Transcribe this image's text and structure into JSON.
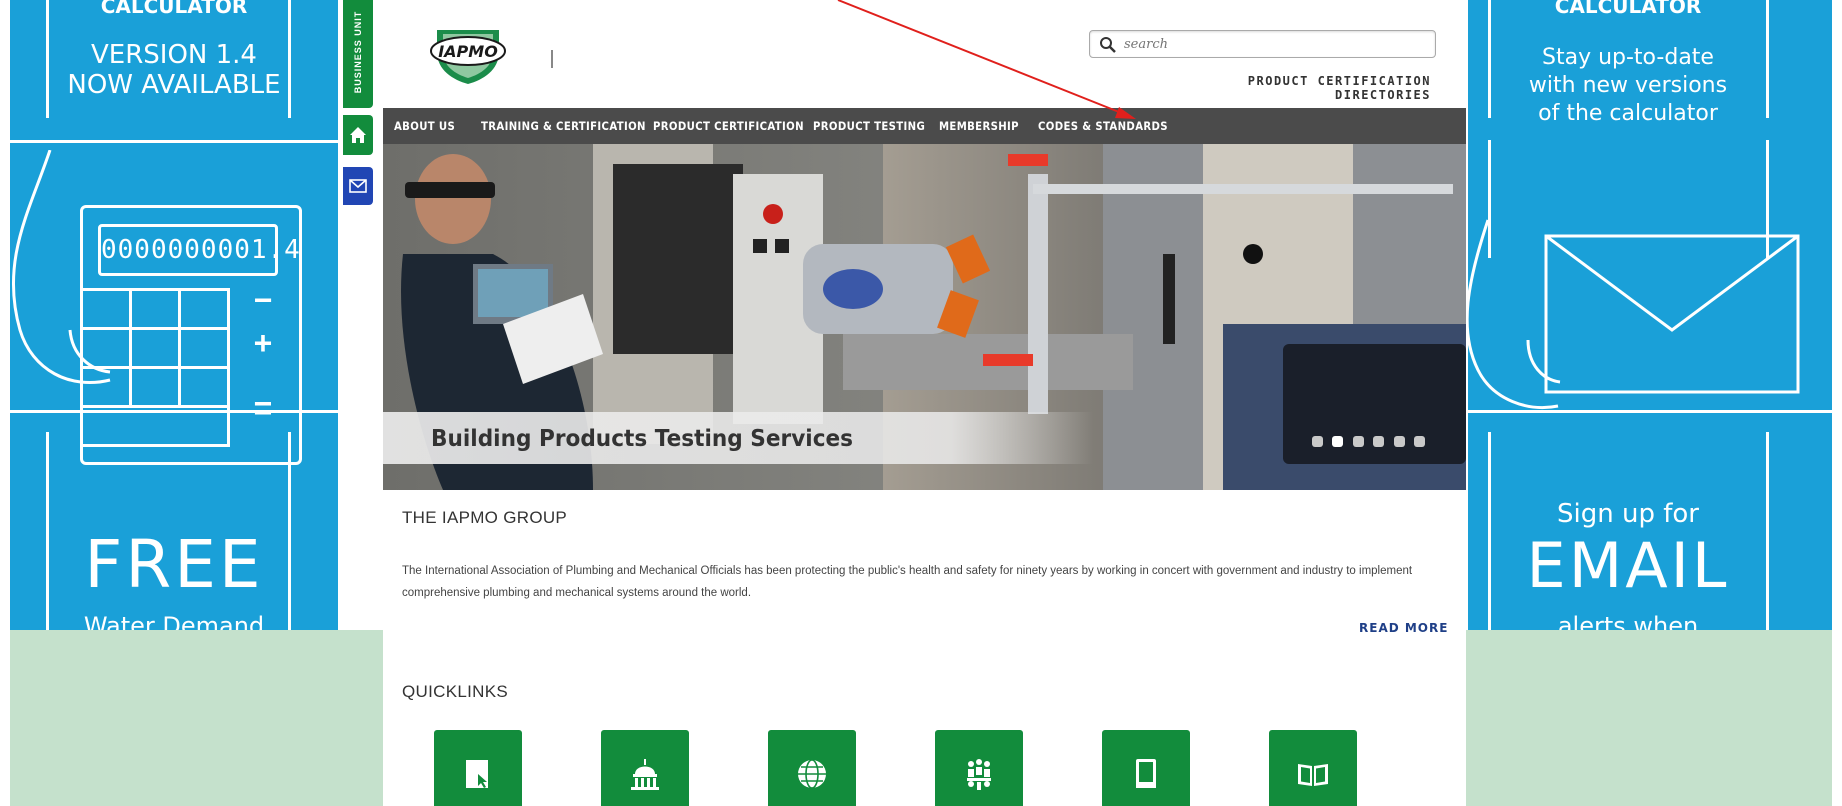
{
  "left_ad": {
    "header_partial": "CALCULATOR",
    "version_line1": "VERSION 1.4",
    "version_line2": "NOW AVAILABLE",
    "calc_display": "0000000001.4",
    "calc_minus": "−",
    "calc_plus": "+",
    "calc_equals": "=",
    "free": "FREE",
    "bottom_partial": "Water Demand"
  },
  "right_ad": {
    "header_partial": "CALCULATOR",
    "line1": "Stay up-to-date",
    "line2": "with new versions",
    "line3": "of the calculator",
    "signup": "Sign up for",
    "email": "EMAIL",
    "bottom_partial": "alerts when"
  },
  "side_tools": {
    "business_unit": "BUSINESS UNIT"
  },
  "header": {
    "logo_text": "IAPMO",
    "search_placeholder": "search",
    "directories_link": "PRODUCT CERTIFICATION DIRECTORIES"
  },
  "nav": {
    "items": [
      {
        "label": "ABOUT US"
      },
      {
        "label": "TRAINING & CERTIFICATION"
      },
      {
        "label": "PRODUCT CERTIFICATION"
      },
      {
        "label": "PRODUCT TESTING"
      },
      {
        "label": "MEMBERSHIP"
      },
      {
        "label": "CODES & STANDARDS"
      }
    ]
  },
  "hero": {
    "caption": "Building Products Testing Services",
    "slide_count": 6,
    "active_slide": 2
  },
  "about": {
    "title": "THE IAPMO GROUP",
    "body": "The International Association of Plumbing and Mechanical Officials has been protecting the public's health and safety for ninety years by working in concert with government and industry to implement comprehensive plumbing and mechanical systems around the world.",
    "read_more": "READ MORE"
  },
  "quicklinks": {
    "title": "QUICKLINKS",
    "tiles": [
      {
        "icon": "cursor-page-icon"
      },
      {
        "icon": "capitol-building-icon"
      },
      {
        "icon": "globe-icon"
      },
      {
        "icon": "people-meeting-icon"
      },
      {
        "icon": "book-icon"
      },
      {
        "icon": "open-book-icon"
      }
    ]
  },
  "colors": {
    "brand_green": "#128c3c",
    "nav_gray": "#4b4b4b",
    "ad_blue": "#1aa0d8",
    "mail_blue": "#2146b4",
    "link_blue": "#1f3f87",
    "annotation_red": "#e0201c"
  }
}
